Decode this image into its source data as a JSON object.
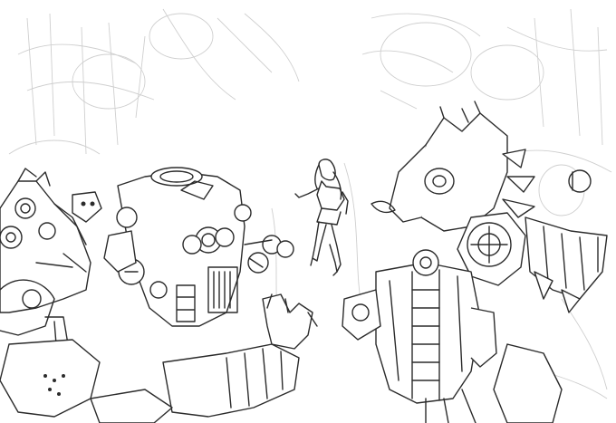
{
  "scene": {
    "medium": "pencil-sketch",
    "background_color": "#ffffff",
    "line_color": "#2b2b2b",
    "construction_line_color": "#cfcfcf"
  }
}
